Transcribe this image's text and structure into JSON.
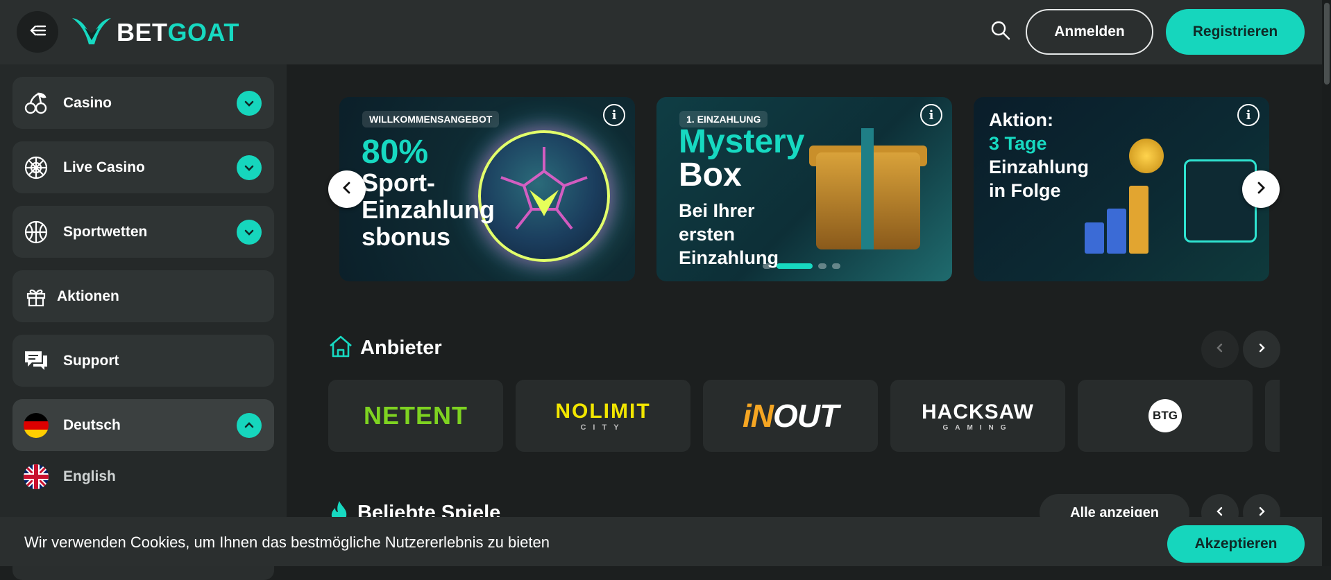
{
  "header": {
    "logo_bet": "BET",
    "logo_goat": "GOAT",
    "login_label": "Anmelden",
    "register_label": "Registrieren",
    "icons": [
      "menu-back-icon",
      "goat-logo-icon",
      "search-icon"
    ]
  },
  "sidebar": {
    "items": [
      {
        "label": "Casino",
        "icon": "cherries-icon",
        "expanded": false
      },
      {
        "label": "Live Casino",
        "icon": "roulette-icon",
        "expanded": false
      },
      {
        "label": "Sportwetten",
        "icon": "basketball-icon",
        "expanded": false
      },
      {
        "label": "Aktionen",
        "icon": "gift-icon"
      },
      {
        "label": "Support",
        "icon": "chat-icon"
      }
    ],
    "language": {
      "current": "Deutsch",
      "current_flag": "germany-flag-icon",
      "expanded": true,
      "options": [
        {
          "label": "English",
          "flag": "uk-flag-icon"
        }
      ]
    }
  },
  "carousel": {
    "banners": [
      {
        "tag": "WILLKOMMENSANGEBOT",
        "headline": "80%",
        "lines": [
          "Sport-",
          "Einzahlung",
          "sbonus"
        ]
      },
      {
        "tag": "1. EINZAHLUNG",
        "headline": "Mystery",
        "headline2": "Box",
        "lines": [
          "Bei Ihrer",
          "ersten",
          "Einzahlung"
        ]
      },
      {
        "line1": "Aktion:",
        "line2": "3 Tage",
        "line3": "Einzahlung",
        "line4": "in Folge"
      }
    ],
    "info_symbol": "i",
    "active_page": 2,
    "page_count": 4
  },
  "providers_section": {
    "title": "Anbieter",
    "icon": "home-icon",
    "providers": [
      {
        "name": "NETENT"
      },
      {
        "name": "NOLIMIT",
        "sub": "CITY"
      },
      {
        "name_in": "iN",
        "name_out": "OUT"
      },
      {
        "name": "HACKSAW",
        "sub": "GAMING"
      },
      {
        "name": "BTG"
      }
    ]
  },
  "popular_section": {
    "title": "Beliebte Spiele",
    "icon": "flame-icon",
    "show_all_label": "Alle anzeigen"
  },
  "cookie_bar": {
    "text": "Wir verwenden Cookies, um Ihnen das bestmögliche Nutzererlebnis zu bieten",
    "accept_label": "Akzeptieren"
  },
  "colors": {
    "accent": "#16d6bd",
    "background": "#1c1f1f",
    "header": "#2b2f2f",
    "sidebar_item": "#2f3434"
  }
}
